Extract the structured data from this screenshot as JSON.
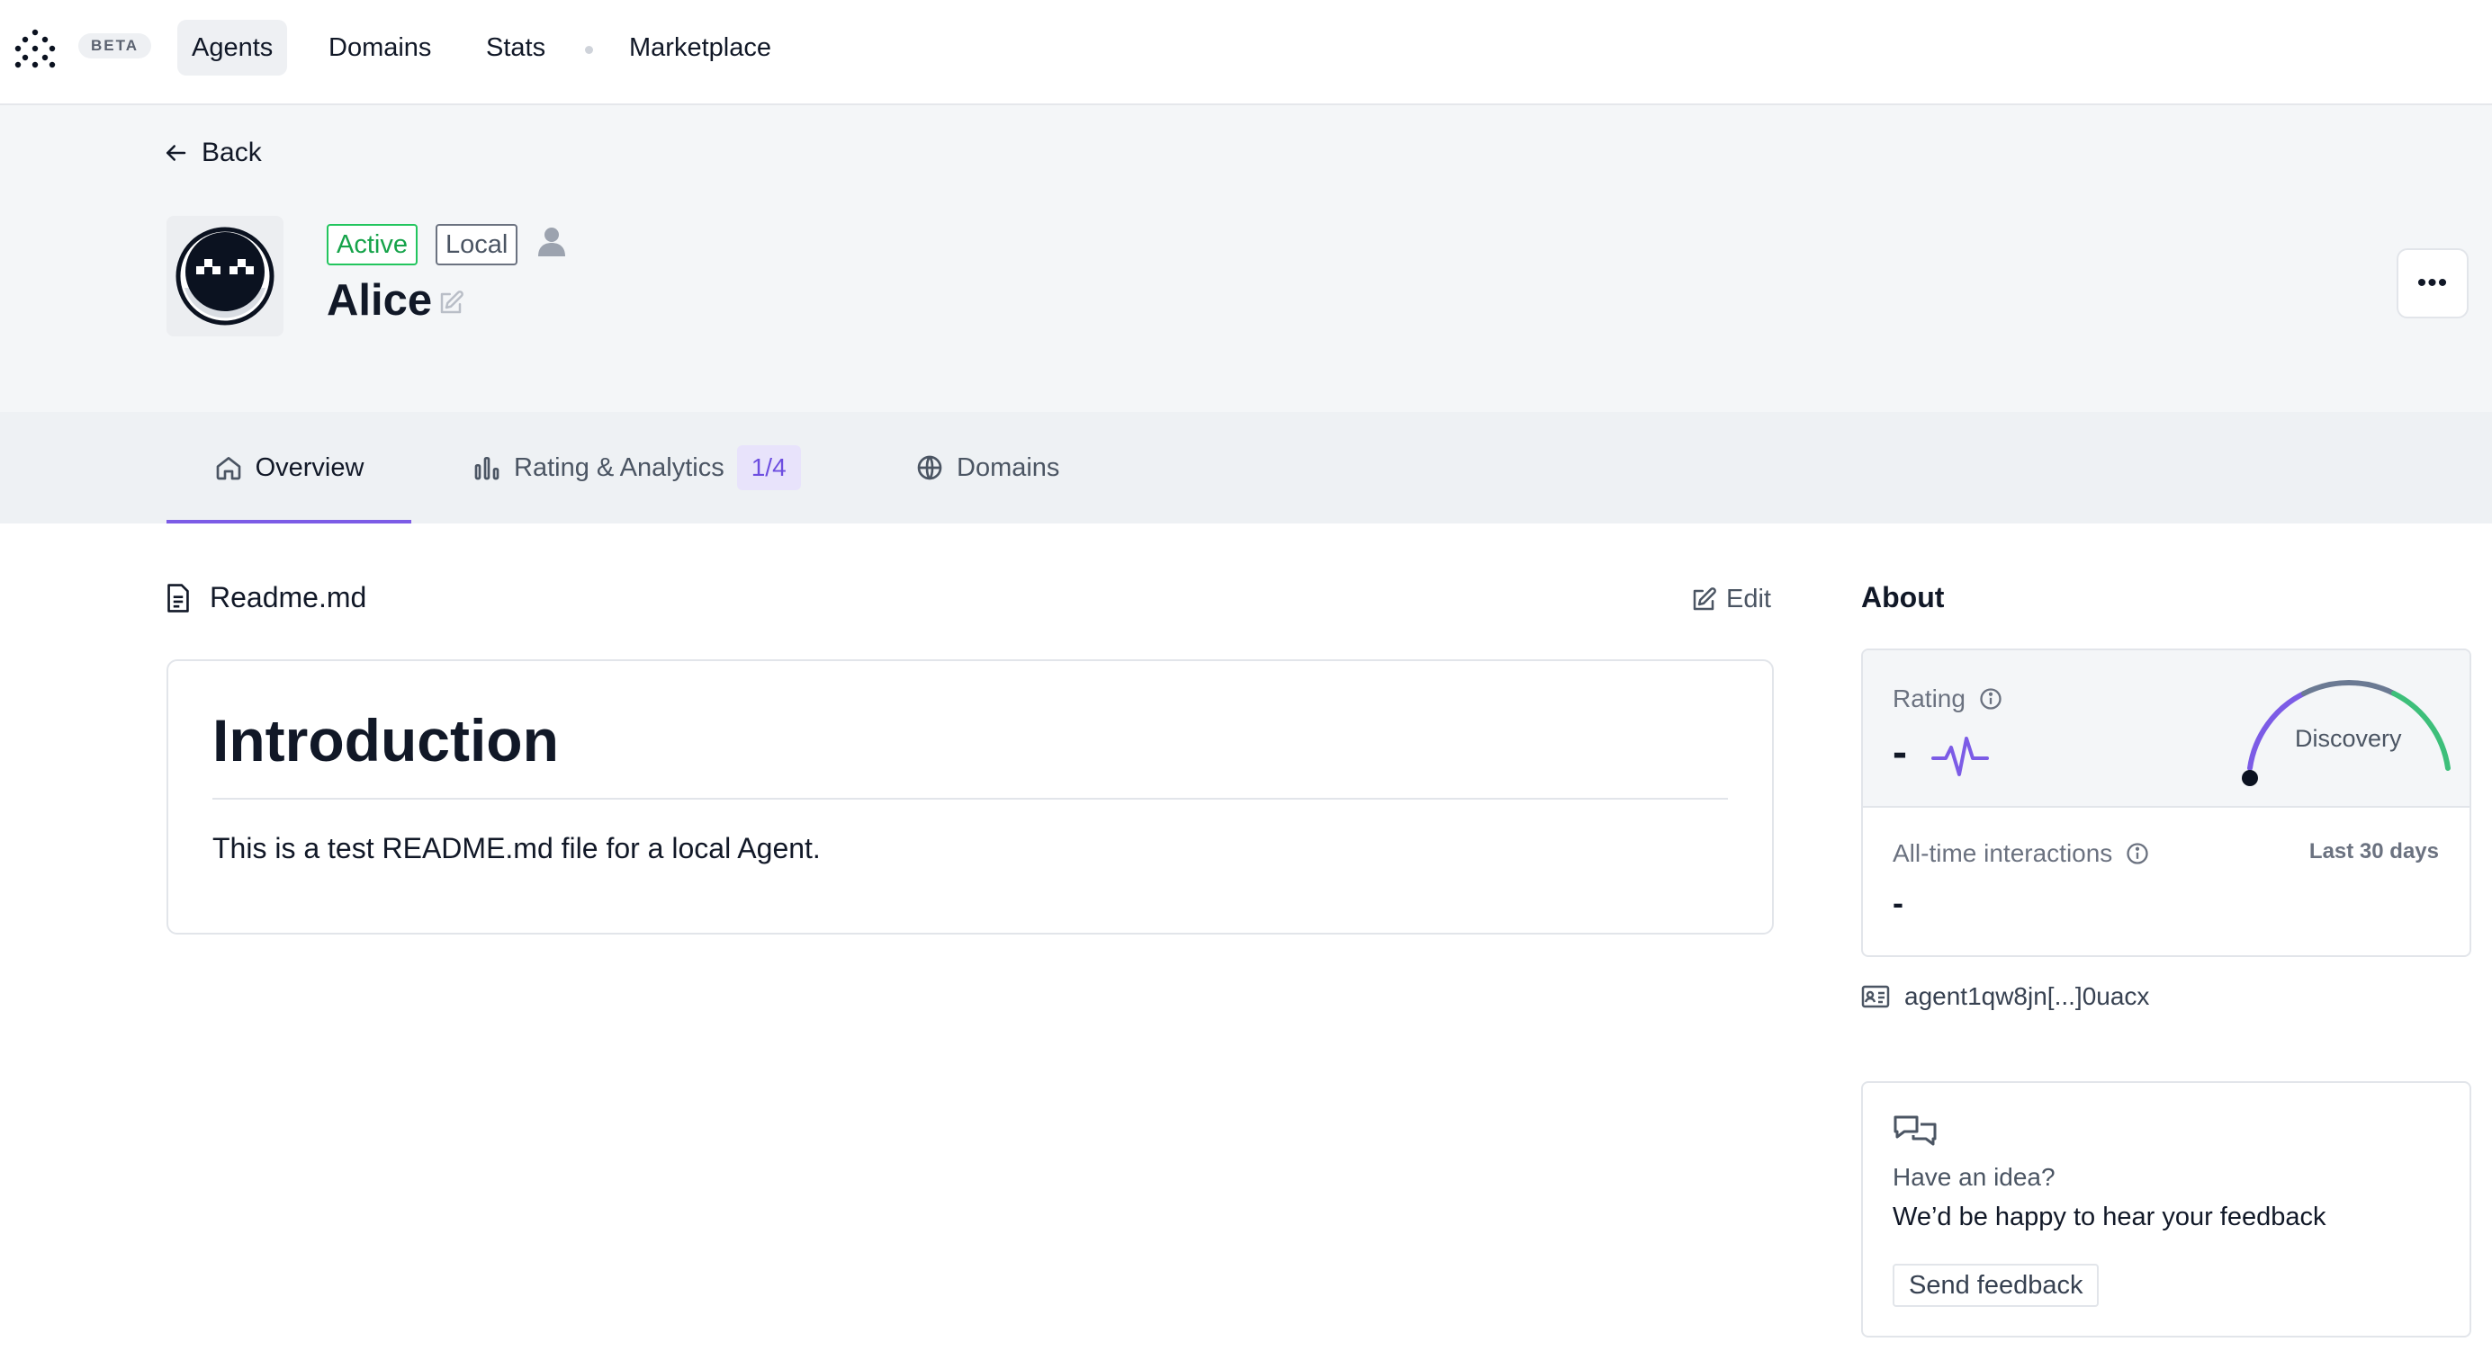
{
  "nav": {
    "beta_label": "BETA",
    "items": [
      "Agents",
      "Domains",
      "Stats",
      "Marketplace"
    ]
  },
  "header": {
    "back_label": "Back",
    "status_badge": "Active",
    "location_badge": "Local",
    "agent_name": "Alice",
    "more_label": "•••"
  },
  "tabs": {
    "overview": "Overview",
    "rating": "Rating & Analytics",
    "rating_count": "1/4",
    "domains": "Domains"
  },
  "readme": {
    "filename": "Readme.md",
    "edit_label": "Edit",
    "heading": "Introduction",
    "body": "This is a test README.md file for a local Agent."
  },
  "about": {
    "title": "About",
    "rating_label": "Rating",
    "rating_value": "-",
    "gauge_label": "Discovery",
    "interactions_label": "All-time interactions",
    "interactions_period": "Last 30 days",
    "interactions_value": "-",
    "address": "agent1qw8jn[...]0uacx"
  },
  "feedback": {
    "question": "Have an idea?",
    "message": "We’d be happy to hear your feedback",
    "button": "Send feedback"
  },
  "colors": {
    "accent": "#7c5ce6",
    "active_green": "#22c55e",
    "gauge_green": "#3dbf7a"
  }
}
